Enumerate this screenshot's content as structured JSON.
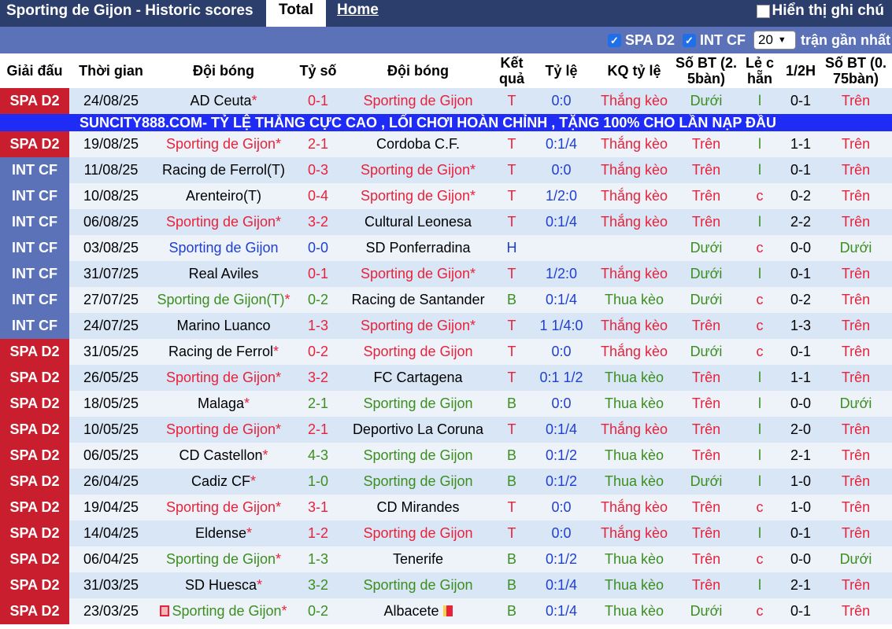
{
  "header": {
    "title": "Sporting de Gijon - Historic scores",
    "tab_total": "Total",
    "tab_home": "Home",
    "show_notes": "Hiển thị ghi chú"
  },
  "filters": {
    "spa": "SPA D2",
    "int": "INT CF",
    "count": "20",
    "recent_label": "trận gần nhất"
  },
  "columns": {
    "league": "Giải đấu",
    "time": "Thời gian",
    "home": "Đội bóng",
    "score": "Tỷ số",
    "away": "Đội bóng",
    "result_l1": "Kết",
    "result_l2": "quả",
    "odds": "Tỷ lệ",
    "odds_result": "KQ tỷ lệ",
    "goals_l1": "Số BT (2.",
    "goals_l2": "5bàn)",
    "oddeven_l1": "Lẻ c",
    "oddeven_l2": "hẵn",
    "half": "1/2H",
    "goals75_l1": "Số BT (0.",
    "goals75_l2": "75bàn)"
  },
  "banner": "SUNCITY888.COM- TỶ LỆ THẮNG CỰC CAO , LỐI CHƠI HOÀN CHỈNH , TẶNG 100% CHO LẦN NẠP ĐẦU",
  "colors": {
    "spa": "#c91e2d",
    "int": "#5b71b8",
    "win": "#e8223a",
    "lose": "#3a8f1e",
    "draw": "#1f3fd0"
  },
  "rows": [
    {
      "league": "SPA D2",
      "date": "24/08/25",
      "home": "AD Ceuta",
      "home_star": "*",
      "home_color": "black",
      "score": "0-1",
      "away": "Sporting de Gijon",
      "away_star": "",
      "away_color": "red",
      "result": "T",
      "result_color": "red",
      "odds": "0:0",
      "odds_result": "Thắng kèo",
      "or_color": "red",
      "goals": "Dưới",
      "goals_color": "green",
      "oe": "l",
      "oe_color": "green",
      "half": "0-1",
      "g75": "Trên",
      "g75_color": "red"
    },
    {
      "league": "SPA D2",
      "date": "19/08/25",
      "home": "Sporting de Gijon",
      "home_star": "*",
      "home_color": "red",
      "score": "2-1",
      "away": "Cordoba C.F.",
      "away_star": "",
      "away_color": "black",
      "result": "T",
      "result_color": "red",
      "odds": "0:1/4",
      "odds_result": "Thắng kèo",
      "or_color": "red",
      "goals": "Trên",
      "goals_color": "red",
      "oe": "l",
      "oe_color": "green",
      "half": "1-1",
      "g75": "Trên",
      "g75_color": "red"
    },
    {
      "league": "INT CF",
      "date": "11/08/25",
      "home": "Racing de Ferrol(T)",
      "home_star": "",
      "home_color": "black",
      "score": "0-3",
      "away": "Sporting de Gijon",
      "away_star": "*",
      "away_color": "red",
      "result": "T",
      "result_color": "red",
      "odds": "0:0",
      "odds_result": "Thắng kèo",
      "or_color": "red",
      "goals": "Trên",
      "goals_color": "red",
      "oe": "l",
      "oe_color": "green",
      "half": "0-1",
      "g75": "Trên",
      "g75_color": "red"
    },
    {
      "league": "INT CF",
      "date": "10/08/25",
      "home": "Arenteiro(T)",
      "home_star": "",
      "home_color": "black",
      "score": "0-4",
      "away": "Sporting de Gijon",
      "away_star": "*",
      "away_color": "red",
      "result": "T",
      "result_color": "red",
      "odds": "1/2:0",
      "odds_result": "Thắng kèo",
      "or_color": "red",
      "goals": "Trên",
      "goals_color": "red",
      "oe": "c",
      "oe_color": "red",
      "half": "0-2",
      "g75": "Trên",
      "g75_color": "red"
    },
    {
      "league": "INT CF",
      "date": "06/08/25",
      "home": "Sporting de Gijon",
      "home_star": "*",
      "home_color": "red",
      "score": "3-2",
      "away": "Cultural Leonesa",
      "away_star": "",
      "away_color": "black",
      "result": "T",
      "result_color": "red",
      "odds": "0:1/4",
      "odds_result": "Thắng kèo",
      "or_color": "red",
      "goals": "Trên",
      "goals_color": "red",
      "oe": "l",
      "oe_color": "green",
      "half": "2-2",
      "g75": "Trên",
      "g75_color": "red"
    },
    {
      "league": "INT CF",
      "date": "03/08/25",
      "home": "Sporting de Gijon",
      "home_star": "",
      "home_color": "blue",
      "score": "0-0",
      "away": "SD Ponferradina",
      "away_star": "",
      "away_color": "black",
      "result": "H",
      "result_color": "blue",
      "odds": "",
      "odds_result": "",
      "or_color": "red",
      "goals": "Dưới",
      "goals_color": "green",
      "oe": "c",
      "oe_color": "red",
      "half": "0-0",
      "g75": "Dưới",
      "g75_color": "green"
    },
    {
      "league": "INT CF",
      "date": "31/07/25",
      "home": "Real Aviles",
      "home_star": "",
      "home_color": "black",
      "score": "0-1",
      "away": "Sporting de Gijon",
      "away_star": "*",
      "away_color": "red",
      "result": "T",
      "result_color": "red",
      "odds": "1/2:0",
      "odds_result": "Thắng kèo",
      "or_color": "red",
      "goals": "Dưới",
      "goals_color": "green",
      "oe": "l",
      "oe_color": "green",
      "half": "0-1",
      "g75": "Trên",
      "g75_color": "red"
    },
    {
      "league": "INT CF",
      "date": "27/07/25",
      "home": "Sporting de Gijon(T)",
      "home_star": "*",
      "home_color": "green",
      "score": "0-2",
      "away": "Racing de Santander",
      "away_star": "",
      "away_color": "black",
      "result": "B",
      "result_color": "green",
      "odds": "0:1/4",
      "odds_result": "Thua kèo",
      "or_color": "green",
      "goals": "Dưới",
      "goals_color": "green",
      "oe": "c",
      "oe_color": "red",
      "half": "0-2",
      "g75": "Trên",
      "g75_color": "red"
    },
    {
      "league": "INT CF",
      "date": "24/07/25",
      "home": "Marino Luanco",
      "home_star": "",
      "home_color": "black",
      "score": "1-3",
      "away": "Sporting de Gijon",
      "away_star": "*",
      "away_color": "red",
      "result": "T",
      "result_color": "red",
      "odds": "1 1/4:0",
      "odds_result": "Thắng kèo",
      "or_color": "red",
      "goals": "Trên",
      "goals_color": "red",
      "oe": "c",
      "oe_color": "red",
      "half": "1-3",
      "g75": "Trên",
      "g75_color": "red"
    },
    {
      "league": "SPA D2",
      "date": "31/05/25",
      "home": "Racing de Ferrol",
      "home_star": "*",
      "home_color": "black",
      "score": "0-2",
      "away": "Sporting de Gijon",
      "away_star": "",
      "away_color": "red",
      "result": "T",
      "result_color": "red",
      "odds": "0:0",
      "odds_result": "Thắng kèo",
      "or_color": "red",
      "goals": "Dưới",
      "goals_color": "green",
      "oe": "c",
      "oe_color": "red",
      "half": "0-1",
      "g75": "Trên",
      "g75_color": "red"
    },
    {
      "league": "SPA D2",
      "date": "26/05/25",
      "home": "Sporting de Gijon",
      "home_star": "*",
      "home_color": "red",
      "score": "3-2",
      "away": "FC Cartagena",
      "away_star": "",
      "away_color": "black",
      "result": "T",
      "result_color": "red",
      "odds": "0:1 1/2",
      "odds_result": "Thua kèo",
      "or_color": "green",
      "goals": "Trên",
      "goals_color": "red",
      "oe": "l",
      "oe_color": "green",
      "half": "1-1",
      "g75": "Trên",
      "g75_color": "red"
    },
    {
      "league": "SPA D2",
      "date": "18/05/25",
      "home": "Malaga",
      "home_star": "*",
      "home_color": "black",
      "score": "2-1",
      "away": "Sporting de Gijon",
      "away_star": "",
      "away_color": "green",
      "result": "B",
      "result_color": "green",
      "odds": "0:0",
      "odds_result": "Thua kèo",
      "or_color": "green",
      "goals": "Trên",
      "goals_color": "red",
      "oe": "l",
      "oe_color": "green",
      "half": "0-0",
      "g75": "Dưới",
      "g75_color": "green"
    },
    {
      "league": "SPA D2",
      "date": "10/05/25",
      "home": "Sporting de Gijon",
      "home_star": "*",
      "home_color": "red",
      "score": "2-1",
      "away": "Deportivo La Coruna",
      "away_star": "",
      "away_color": "black",
      "result": "T",
      "result_color": "red",
      "odds": "0:1/4",
      "odds_result": "Thắng kèo",
      "or_color": "red",
      "goals": "Trên",
      "goals_color": "red",
      "oe": "l",
      "oe_color": "green",
      "half": "2-0",
      "g75": "Trên",
      "g75_color": "red"
    },
    {
      "league": "SPA D2",
      "date": "06/05/25",
      "home": "CD Castellon",
      "home_star": "*",
      "home_color": "black",
      "score": "4-3",
      "away": "Sporting de Gijon",
      "away_star": "",
      "away_color": "green",
      "result": "B",
      "result_color": "green",
      "odds": "0:1/2",
      "odds_result": "Thua kèo",
      "or_color": "green",
      "goals": "Trên",
      "goals_color": "red",
      "oe": "l",
      "oe_color": "green",
      "half": "2-1",
      "g75": "Trên",
      "g75_color": "red"
    },
    {
      "league": "SPA D2",
      "date": "26/04/25",
      "home": "Cadiz CF",
      "home_star": "*",
      "home_color": "black",
      "score": "1-0",
      "away": "Sporting de Gijon",
      "away_star": "",
      "away_color": "green",
      "result": "B",
      "result_color": "green",
      "odds": "0:1/2",
      "odds_result": "Thua kèo",
      "or_color": "green",
      "goals": "Dưới",
      "goals_color": "green",
      "oe": "l",
      "oe_color": "green",
      "half": "1-0",
      "g75": "Trên",
      "g75_color": "red"
    },
    {
      "league": "SPA D2",
      "date": "19/04/25",
      "home": "Sporting de Gijon",
      "home_star": "*",
      "home_color": "red",
      "score": "3-1",
      "away": "CD Mirandes",
      "away_star": "",
      "away_color": "black",
      "result": "T",
      "result_color": "red",
      "odds": "0:0",
      "odds_result": "Thắng kèo",
      "or_color": "red",
      "goals": "Trên",
      "goals_color": "red",
      "oe": "c",
      "oe_color": "red",
      "half": "1-0",
      "g75": "Trên",
      "g75_color": "red"
    },
    {
      "league": "SPA D2",
      "date": "14/04/25",
      "home": "Eldense",
      "home_star": "*",
      "home_color": "black",
      "score": "1-2",
      "away": "Sporting de Gijon",
      "away_star": "",
      "away_color": "red",
      "result": "T",
      "result_color": "red",
      "odds": "0:0",
      "odds_result": "Thắng kèo",
      "or_color": "red",
      "goals": "Trên",
      "goals_color": "red",
      "oe": "l",
      "oe_color": "green",
      "half": "0-1",
      "g75": "Trên",
      "g75_color": "red"
    },
    {
      "league": "SPA D2",
      "date": "06/04/25",
      "home": "Sporting de Gijon",
      "home_star": "*",
      "home_color": "green",
      "score": "1-3",
      "away": "Tenerife",
      "away_star": "",
      "away_color": "black",
      "result": "B",
      "result_color": "green",
      "odds": "0:1/2",
      "odds_result": "Thua kèo",
      "or_color": "green",
      "goals": "Trên",
      "goals_color": "red",
      "oe": "c",
      "oe_color": "red",
      "half": "0-0",
      "g75": "Dưới",
      "g75_color": "green"
    },
    {
      "league": "SPA D2",
      "date": "31/03/25",
      "home": "SD Huesca",
      "home_star": "*",
      "home_color": "black",
      "score": "3-2",
      "away": "Sporting de Gijon",
      "away_star": "",
      "away_color": "green",
      "result": "B",
      "result_color": "green",
      "odds": "0:1/4",
      "odds_result": "Thua kèo",
      "or_color": "green",
      "goals": "Trên",
      "goals_color": "red",
      "oe": "l",
      "oe_color": "green",
      "half": "2-1",
      "g75": "Trên",
      "g75_color": "red"
    },
    {
      "league": "SPA D2",
      "date": "23/03/25",
      "home": "Sporting de Gijon",
      "home_star": "*",
      "home_color": "green",
      "home_flag": true,
      "score": "0-2",
      "away": "Albacete",
      "away_star": "",
      "away_color": "black",
      "away_flag": true,
      "result": "B",
      "result_color": "green",
      "odds": "0:1/4",
      "odds_result": "Thua kèo",
      "or_color": "green",
      "goals": "Dưới",
      "goals_color": "green",
      "oe": "c",
      "oe_color": "red",
      "half": "0-1",
      "g75": "Trên",
      "g75_color": "red"
    }
  ]
}
